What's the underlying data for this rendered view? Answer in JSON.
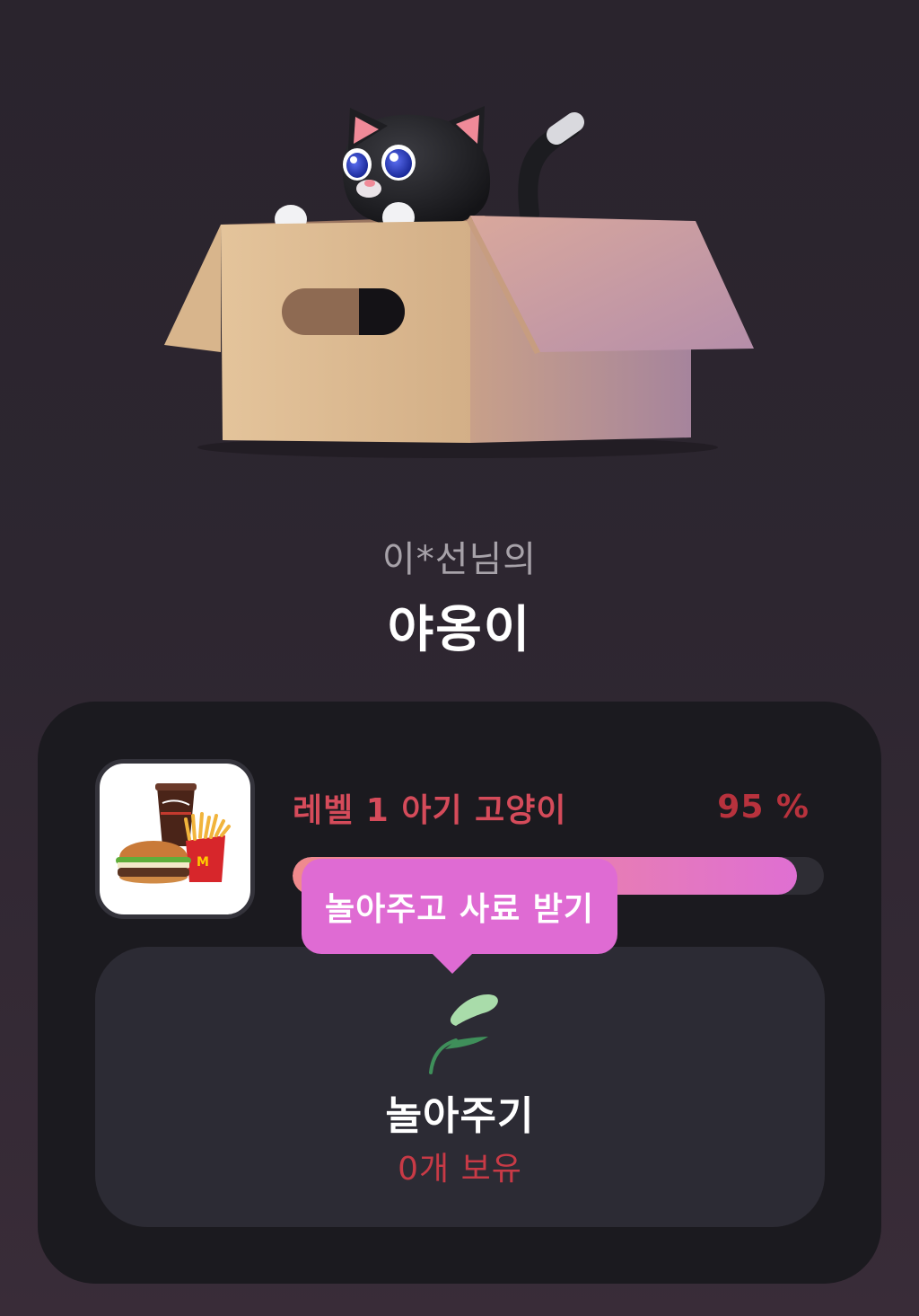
{
  "hero": {
    "image": "cat-in-box-illustration"
  },
  "owner_label": "이*선님의",
  "pet_name": "야옹이",
  "card": {
    "reward_image": "burger-set-reward-image",
    "level_label": "레벨 1 아기 고양이",
    "progress_percent": 95,
    "progress_label": "95 %",
    "tooltip": "놀아주고 사료 받기",
    "play": {
      "icon": "leaf-toy-icon",
      "title": "놀아주기",
      "count_label": "0개 보유"
    }
  },
  "colors": {
    "background": "#2d2630",
    "card": "#1b1a1f",
    "panel": "#2c2b34",
    "accent_pink": "#df6bd3",
    "accent_red": "#c83a46"
  }
}
